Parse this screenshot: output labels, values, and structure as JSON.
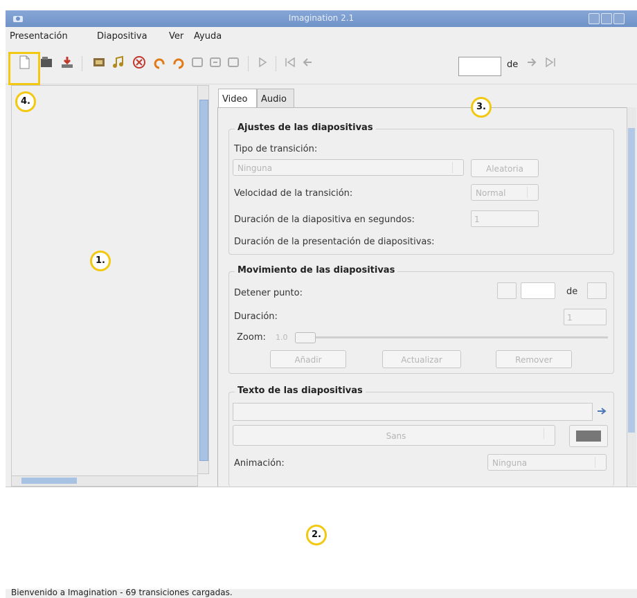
{
  "window": {
    "title": "Imagination 2.1"
  },
  "menu": [
    "Presentación",
    "Diapositiva",
    "Ver",
    "Ayuda"
  ],
  "toolbar": {
    "slide_suffix": "de"
  },
  "tabs": [
    "Video",
    "Audio"
  ],
  "slide_settings": {
    "title": "Ajustes de las diapositivas",
    "transition_type_label": "Tipo de transición:",
    "transition_value": "Ninguna",
    "random_button": "Aleatoria",
    "speed_label": "Velocidad de la transición:",
    "speed_value": "Normal",
    "duration_label": "Duración de la diapositiva en segundos:",
    "duration_value": "1",
    "presentation_duration_label": "Duración de la presentación de diapositivas:"
  },
  "motion": {
    "title": "Movimiento de las diapositivas",
    "stop_point_label": "Detener punto:",
    "of_label": "de",
    "duration_label": "Duración:",
    "duration_value": "1",
    "zoom_label": "Zoom:",
    "zoom_value": "1.0",
    "add_button": "Añadir",
    "update_button": "Actualizar",
    "remove_button": "Remover"
  },
  "slide_text": {
    "title": "Texto de las diapositivas",
    "font_value": "Sans",
    "animation_label": "Animación:",
    "animation_value": "Ninguna"
  },
  "callouts": [
    "1.",
    "2.",
    "3.",
    "4."
  ],
  "status": "Bienvenido a Imagination - 69 transiciones cargadas."
}
